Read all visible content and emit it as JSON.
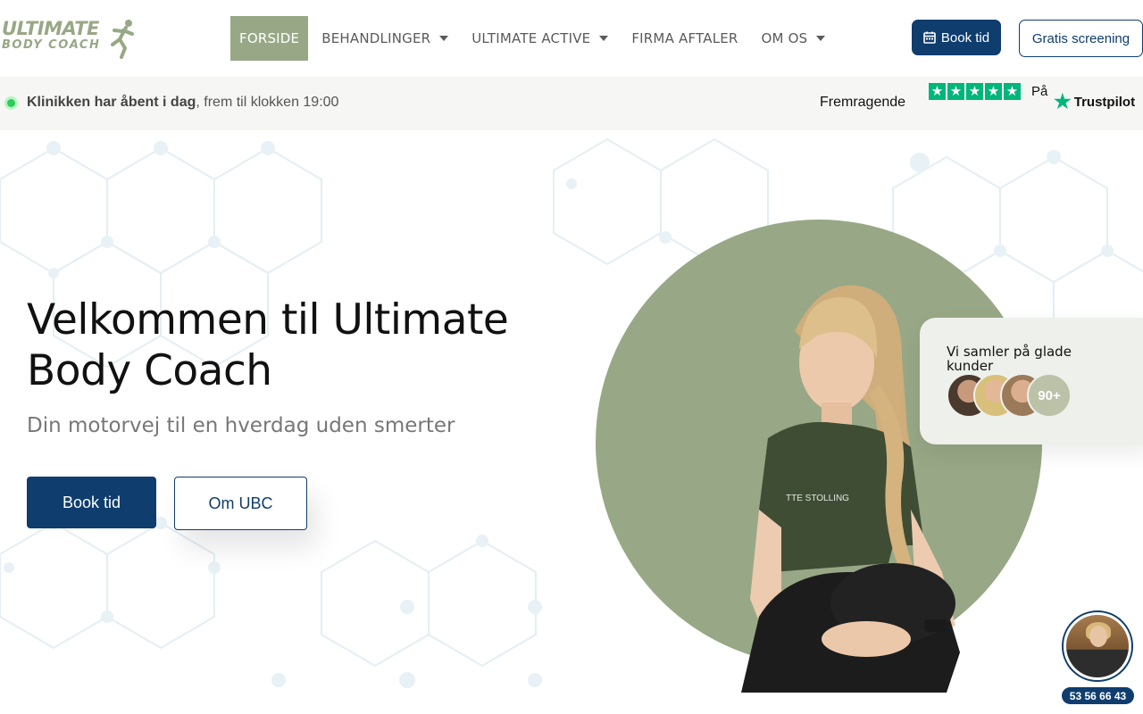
{
  "brand": {
    "logo_line1": "ULTIMATE",
    "logo_line2": "BODY COACH",
    "accent": "#98a886",
    "primary": "#0e3d6e"
  },
  "nav": {
    "items": [
      {
        "label": "FORSIDE",
        "active": true,
        "has_dropdown": false
      },
      {
        "label": "BEHANDLINGER",
        "active": false,
        "has_dropdown": true
      },
      {
        "label": "ULTIMATE ACTIVE",
        "active": false,
        "has_dropdown": true
      },
      {
        "label": "FIRMA AFTALER",
        "active": false,
        "has_dropdown": false
      },
      {
        "label": "OM OS",
        "active": false,
        "has_dropdown": true
      }
    ],
    "book_label": "Book tid",
    "screening_label": "Gratis screening"
  },
  "infobar": {
    "open_bold": "Klinikken har åbent i dag",
    "open_rest": ", frem til klokken 19:00",
    "rating_label": "Fremragende",
    "on_label": "På",
    "trustpilot": "Trustpilot"
  },
  "hero": {
    "title": "Velkommen til Ultimate Body Coach",
    "subtitle": "Din motorvej til en hverdag uden smerter",
    "book_button": "Book tid",
    "about_button": "Om UBC",
    "tshirt_text": "TTE STOLLING"
  },
  "customers": {
    "text": "Vi samler på glade kunder",
    "count": "90+"
  },
  "chat": {
    "phone": "53 56 66 43"
  }
}
